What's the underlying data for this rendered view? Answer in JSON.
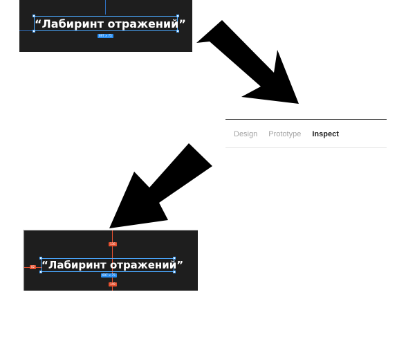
{
  "top_canvas": {
    "title_text": "“Лабиринт отражений”",
    "size_badge": "697 × 75"
  },
  "inspector": {
    "tabs": [
      {
        "label": "Design",
        "active": false
      },
      {
        "label": "Prototype",
        "active": false
      },
      {
        "label": "Inspect",
        "active": true
      }
    ]
  },
  "bottom_canvas": {
    "title_text": "“Лабиринт отражений”",
    "size_badge": "697 × 75",
    "measure_top": "136",
    "measure_left": "82",
    "measure_bottom": "149"
  },
  "colors": {
    "canvas_bg": "#1e1e1e",
    "selection": "#4aa8ff",
    "size_badge": "#2b8ff2",
    "measure": "#e6502e",
    "tab_active": "#1f1f1f",
    "tab_inactive": "#a3a3a3",
    "arrow": "#000000"
  }
}
